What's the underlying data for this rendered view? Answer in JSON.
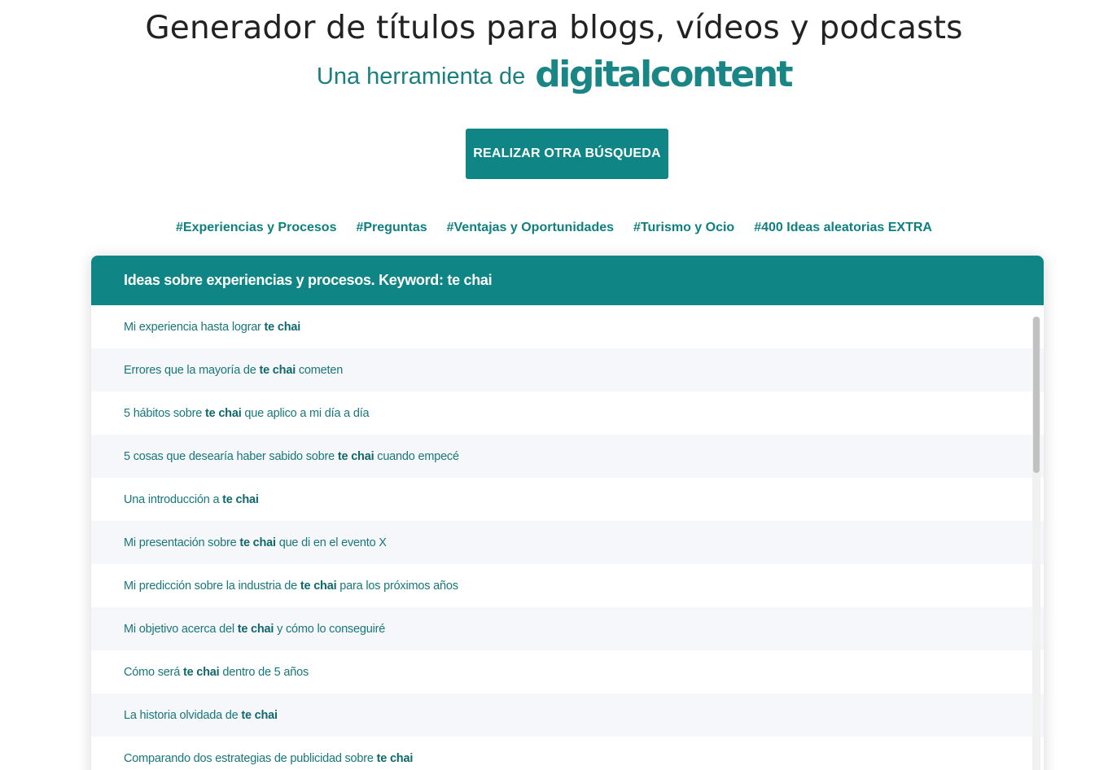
{
  "header": {
    "title": "Generador de títulos para blogs, vídeos y podcasts",
    "subtitle_prefix": "Una herramienta de",
    "brand": "digitalcontent"
  },
  "actions": {
    "search_again_label": "REALIZAR OTRA BÚSQUEDA"
  },
  "tags": [
    "#Experiencias y Procesos",
    "#Preguntas",
    "#Ventajas y Oportunidades",
    "#Turismo y Ocio",
    "#400 Ideas aleatorias EXTRA"
  ],
  "panel": {
    "heading": "Ideas sobre experiencias y procesos. Keyword: te chai",
    "keyword": "te chai",
    "items": [
      {
        "before": "Mi experiencia hasta lograr",
        "after": ""
      },
      {
        "before": "Errores que la mayoría de",
        "after": "cometen"
      },
      {
        "before": "5 hábitos sobre",
        "after": "que aplico a mi día a día"
      },
      {
        "before": "5 cosas que desearía haber sabido sobre",
        "after": "cuando empecé"
      },
      {
        "before": "Una introducción a",
        "after": ""
      },
      {
        "before": "Mi presentación sobre",
        "after": "que di en el evento X"
      },
      {
        "before": "Mi predicción sobre la industria de",
        "after": "para los próximos años"
      },
      {
        "before": "Mi objetivo acerca del",
        "after": "y cómo lo conseguiré"
      },
      {
        "before": "Cómo será",
        "after": "dentro de 5 años"
      },
      {
        "before": "La historia olvidada de",
        "after": ""
      },
      {
        "before": "Comparando dos estrategias de publicidad sobre",
        "after": ""
      }
    ]
  },
  "colors": {
    "accent": "#0f8585",
    "text_teal": "#17777a",
    "row_alt": "#f6f7fb"
  }
}
